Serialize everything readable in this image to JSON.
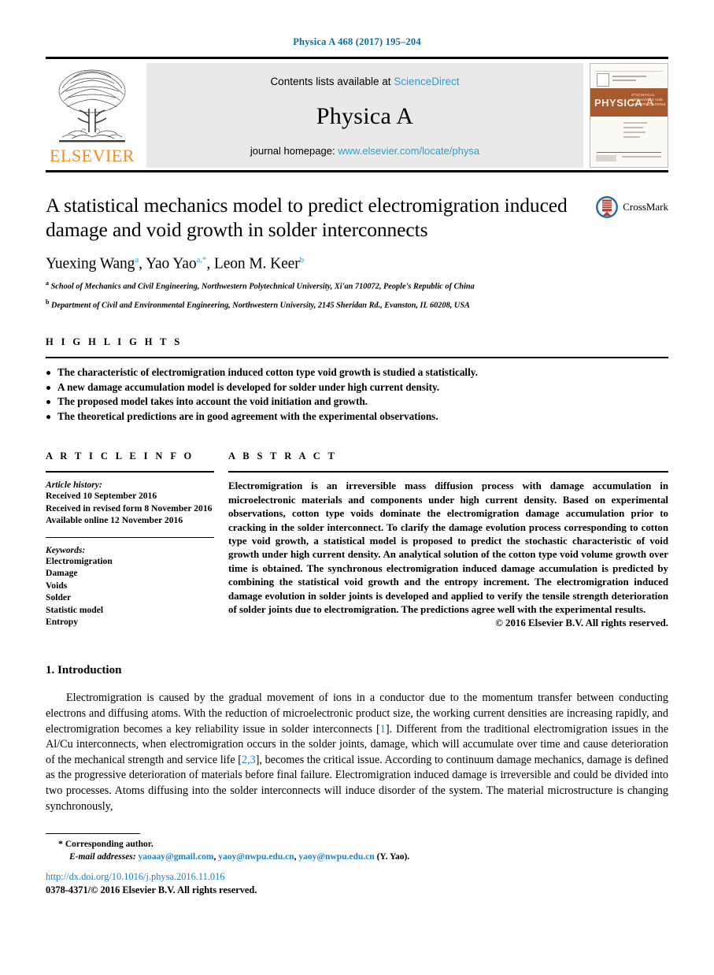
{
  "running_head": "Physica A 468 (2017) 195–204",
  "masthead": {
    "elsevier_wordmark": "ELSEVIER",
    "contents_prefix": "Contents lists available at ",
    "contents_link": "ScienceDirect",
    "journal_title": "Physica A",
    "homepage_prefix": "journal homepage: ",
    "homepage_url": "www.elsevier.com/locate/physa",
    "cover": {
      "brand": "PHYSICA",
      "volume_letter": "A",
      "subtitle": "STATISTICAL MECHANICS AND ITS APPLICATIONS"
    },
    "link_color": "#2a9fd6"
  },
  "article": {
    "title": "A statistical mechanics model to predict electromigration induced damage and void growth in solder interconnects",
    "crossmark_label": "CrossMark",
    "authors_html": "Yuexing Wang<sup>a</sup>, Yao Yao<sup>a,*</sup>, Leon M. Keer<sup>b</sup>",
    "affiliations": [
      {
        "marker": "a",
        "text": "School of Mechanics and Civil Engineering, Northwestern Polytechnical University, Xi'an 710072, People's Republic of China"
      },
      {
        "marker": "b",
        "text": "Department of Civil and Environmental Engineering, Northwestern University, 2145 Sheridan Rd., Evanston, IL 60208, USA"
      }
    ]
  },
  "highlights": {
    "label": "H I G H L I G H T S",
    "items": [
      "The characteristic of electromigration induced cotton type void growth is studied a statistically.",
      "A new damage accumulation model is developed for solder under high current density.",
      "The proposed model takes into account the void initiation and growth.",
      "The theoretical predictions are in good agreement with the experimental observations."
    ]
  },
  "article_info": {
    "label": "A R T I C L E    I N F O",
    "history_label": "Article history:",
    "history": [
      "Received 10 September 2016",
      "Received in revised form 8 November 2016",
      "Available online 12 November 2016"
    ],
    "keywords_label": "Keywords:",
    "keywords": [
      "Electromigration",
      "Damage",
      "Voids",
      "Solder",
      "Statistic model",
      "Entropy"
    ]
  },
  "abstract": {
    "label": "A B S T R A C T",
    "text": "Electromigration is an irreversible mass diffusion process with damage accumulation in microelectronic materials and components under high current density. Based on experimental observations, cotton type voids dominate the electromigration damage accumulation prior to cracking in the solder interconnect. To clarify the damage evolution process corresponding to cotton type void growth, a statistical model is proposed to predict the stochastic characteristic of void growth under high current density. An analytical solution of the cotton type void volume growth over time is obtained. The synchronous electromigration induced damage accumulation is predicted by combining the statistical void growth and the entropy increment. The electromigration induced damage evolution in solder joints is developed and applied to verify the tensile strength deterioration of solder joints due to electromigration. The predictions agree well with the experimental results.",
    "copyright": "© 2016 Elsevier B.V. All rights reserved."
  },
  "body": {
    "section_heading": "1. Introduction",
    "paragraph_parts": {
      "p1": "Electromigration is caused by the gradual movement of ions in a conductor due to the momentum transfer between conducting electrons and diffusing atoms. With the reduction of microelectronic product size, the working current densities are increasing rapidly, and electromigration becomes a key reliability issue in solder interconnects [",
      "cite1": "1",
      "p2": "]. Different from the traditional electromigration issues in the Al/Cu interconnects, when electromigration occurs in the solder joints, damage, which will accumulate over time and cause deterioration of the mechanical strength and service life [",
      "cite2": "2,3",
      "p3": "], becomes the critical issue. According to continuum damage mechanics, damage is defined as the progressive deterioration of materials before final failure. Electromigration induced damage is irreversible and could be divided into two processes. Atoms diffusing into the solder interconnects will induce disorder of the system. The material microstructure is changing synchronously,"
    }
  },
  "footnote": {
    "star": "*",
    "corresponding": "Corresponding author.",
    "email_label": "E-mail addresses:",
    "emails": [
      "yaoaay@gmail.com",
      "yaoy@nwpu.edu.cn",
      "yaoy@nwpu.edu.cn"
    ],
    "email_suffix": "(Y. Yao).",
    "doi": "http://dx.doi.org/10.1016/j.physa.2016.11.016",
    "issn_line": "0378-4371/© 2016 Elsevier B.V. All rights reserved."
  }
}
